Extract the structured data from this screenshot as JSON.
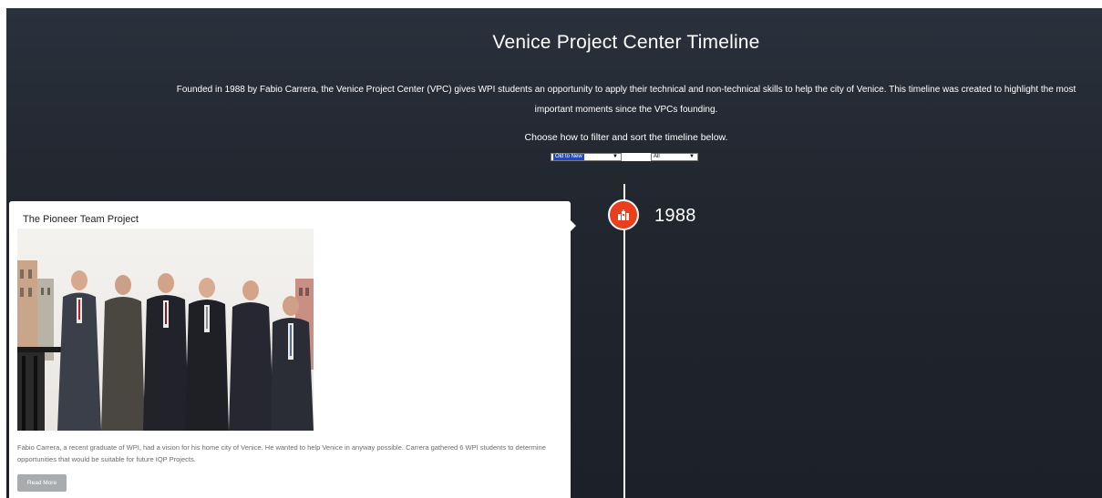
{
  "header": {
    "title": "Venice Project Center Timeline",
    "intro": "Founded in 1988 by Fabio Carrera, the Venice Project Center (VPC) gives WPI students an opportunity to apply their technical and non-technical skills to help the city of Venice. This timeline was created to highlight the most important moments since the VPCs founding.",
    "filter_label": "Choose how to filter and sort the timeline below."
  },
  "filters": {
    "sort_selected": "Old to New",
    "category_selected": "All"
  },
  "timeline": {
    "year": "1988",
    "marker_icon": "city-icon",
    "accent_color": "#e8401c"
  },
  "card": {
    "title": "The Pioneer Team Project",
    "description": "Fabio Carrera, a recent graduate of WPI, had a vision for his home city of Venice. He wanted to help Venice in anyway possible. Carrera gathered 6 WPI students to determine opportunities that would be suitable for future IQP Projects.",
    "read_more_label": "Read More"
  }
}
